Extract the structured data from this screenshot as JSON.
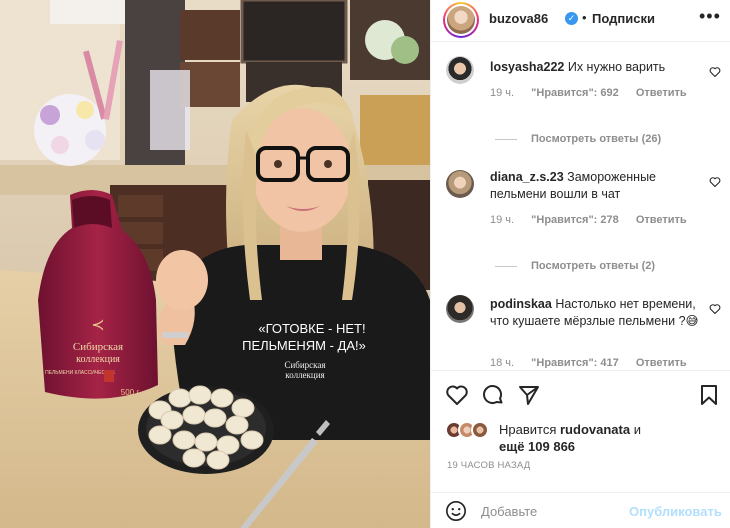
{
  "post": {
    "username": "buzova86",
    "separator": "•",
    "follow_label": "Подписки",
    "more_label": "•••",
    "shirt_line1": "«ГОТОВКЕ - НЕТ!",
    "shirt_line2": "ПЕЛЬМЕНЯМ - ДА!»",
    "shirt_brand1": "Сибирская",
    "shirt_brand2": "коллекция",
    "bag_brand1": "Сибирская",
    "bag_brand2": "коллекция",
    "bag_sub": "ПЕЛЬМЕНИ КЛАССИЧЕСКИЕ",
    "bag_weight": "500 г"
  },
  "comments": [
    {
      "username": "losyasha222",
      "text": "Их нужно варить",
      "age": "19 ч.",
      "likes": "\"Нравится\": 692",
      "reply": "Ответить",
      "view_replies": "Посмотреть ответы (26)"
    },
    {
      "username": "diana_z.s.23",
      "text": "Замороженные пельмени вошли в чат",
      "age": "19 ч.",
      "likes": "\"Нравится\": 278",
      "reply": "Ответить",
      "view_replies": "Посмотреть ответы (2)"
    },
    {
      "username": "podinskaa",
      "text": "Настолько нет времени, что кушаете мёрзлые пельмени ?😅",
      "age": "18 ч.",
      "likes": "\"Нравится\": 417",
      "reply": "Ответить"
    }
  ],
  "likes_block": {
    "prefix": "Нравится",
    "liked_user": "rudovanata",
    "conj": "и",
    "more": "ещё 109 866"
  },
  "timestamp": "19 ЧАСОВ НАЗАД",
  "composer": {
    "placeholder": "Добавьте",
    "publish_label": "Опубликовать"
  },
  "icons": {
    "verified": "verified-badge-icon",
    "like": "heart-icon",
    "comment": "speech-bubble-icon",
    "share": "paper-plane-icon",
    "save": "bookmark-icon",
    "emoji": "smiley-icon"
  },
  "colors": {
    "verified": "#3897f0",
    "publish_disabled": "#b2dffc",
    "secondary_text": "#8e8e8e",
    "bag": "#8b1a3a"
  }
}
